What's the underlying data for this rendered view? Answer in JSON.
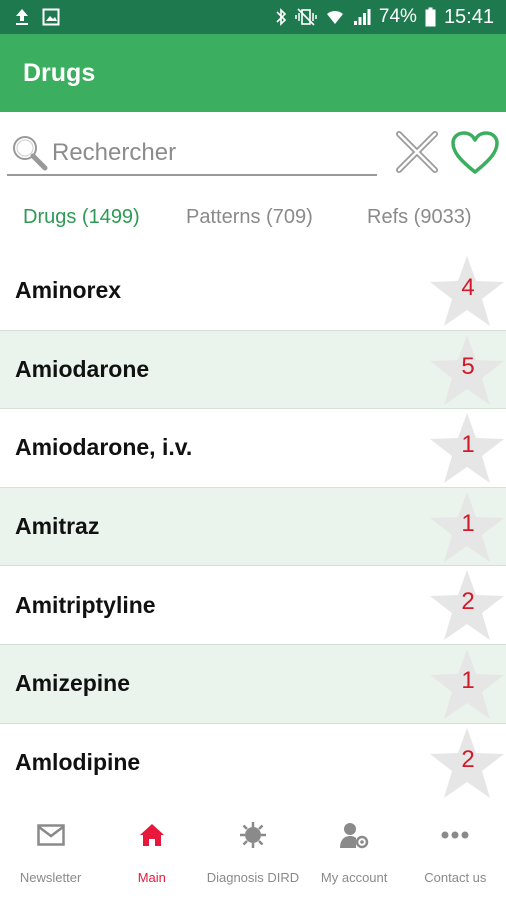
{
  "status_bar": {
    "battery": "74%",
    "time": "15:41",
    "icons": [
      "upload-icon",
      "image-icon",
      "bluetooth-icon",
      "vibrate-icon",
      "wifi-icon",
      "signal-icon",
      "battery-icon"
    ]
  },
  "app_bar": {
    "title": "Drugs",
    "color": "#3cae5f"
  },
  "search": {
    "placeholder": "Rechercher",
    "value": ""
  },
  "tabs": [
    {
      "label": "Drugs (1499)",
      "active": true
    },
    {
      "label": "Patterns (709)",
      "active": false
    },
    {
      "label": "Refs (9033)",
      "active": false
    }
  ],
  "drugs": [
    {
      "name": "Aminorex",
      "count": "4"
    },
    {
      "name": "Amiodarone",
      "count": "5"
    },
    {
      "name": "Amiodarone, i.v.",
      "count": "1"
    },
    {
      "name": "Amitraz",
      "count": "1"
    },
    {
      "name": "Amitriptyline",
      "count": "2"
    },
    {
      "name": "Amizepine",
      "count": "1"
    },
    {
      "name": "Amlodipine",
      "count": "2"
    }
  ],
  "bottom_nav": [
    {
      "label": "Newsletter",
      "icon": "envelope-icon",
      "active": false
    },
    {
      "label": "Main",
      "icon": "home-icon",
      "active": true
    },
    {
      "label": "Diagnosis DIRD",
      "icon": "virus-icon",
      "active": false
    },
    {
      "label": "My account",
      "icon": "user-settings-icon",
      "active": false
    },
    {
      "label": "Contact us",
      "icon": "more-icon",
      "active": false
    }
  ],
  "colors": {
    "status_bar": "#1e7a4e",
    "accent": "#2e9a54",
    "alt_row": "#eaf4ec",
    "count": "#d11a2a",
    "active_nav": "#e8183c"
  }
}
